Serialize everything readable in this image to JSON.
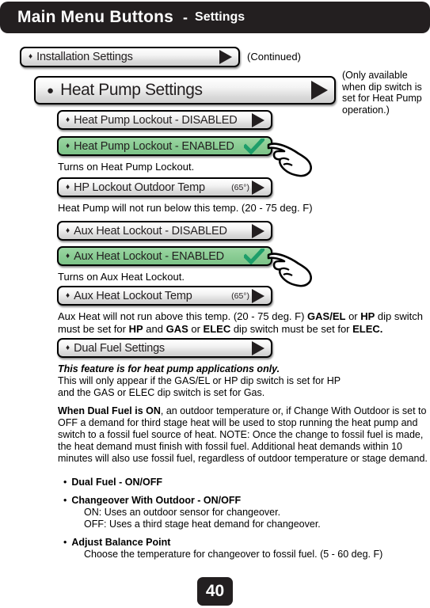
{
  "header": {
    "title": "Main Menu Buttons",
    "separator": "-",
    "subtitle": "Settings"
  },
  "buttons": {
    "installation_settings": {
      "label": "Installation Settings",
      "bullet": "♦",
      "arrow": "right-arrow"
    },
    "heat_pump_settings": {
      "label": "Heat Pump Settings",
      "bullet": "●",
      "arrow": "right-arrow"
    },
    "hp_lockout_disabled": {
      "label": "Heat Pump Lockout - DISABLED",
      "bullet": "♦",
      "arrow": "right-arrow"
    },
    "hp_lockout_enabled": {
      "label": "Heat Pump Lockout - ENABLED",
      "bullet": "♦",
      "state": "selected",
      "check": "checkmark"
    },
    "hp_lockout_outdoor_temp": {
      "label": "HP Lockout Outdoor Temp",
      "value": "(65°)",
      "bullet": "♦",
      "arrow": "right-arrow"
    },
    "aux_lockout_disabled": {
      "label": "Aux Heat Lockout - DISABLED",
      "bullet": "♦",
      "arrow": "right-arrow"
    },
    "aux_lockout_enabled": {
      "label": "Aux Heat Lockout - ENABLED",
      "bullet": "♦",
      "state": "selected",
      "check": "checkmark"
    },
    "aux_lockout_temp": {
      "label": "Aux Heat Lockout Temp",
      "value": "(65°)",
      "bullet": "♦",
      "arrow": "right-arrow"
    },
    "dual_fuel_settings": {
      "label": "Dual Fuel Settings",
      "bullet": "♦",
      "arrow": "right-arrow"
    }
  },
  "annotations": {
    "continued": "(Continued)",
    "dip_switch_note": "(Only available when dip switch is set for Heat Pump operation.)"
  },
  "descriptions": {
    "hp_lockout": "Turns on Heat Pump Lockout.",
    "hp_lockout_temp": "Heat Pump will not run below this temp. (20 - 75 deg. F)",
    "aux_lockout": "Turns on Aux Heat Lockout.",
    "aux_lockout_temp_line1_a": "Aux Heat will not run above this temp. (20 - 75 deg. F) ",
    "aux_lockout_temp_b1": "GAS/EL",
    "aux_lockout_temp_line1_b": " or ",
    "aux_lockout_temp_b2": "HP",
    "aux_lockout_temp_line1_c": " dip",
    "aux_lockout_temp_line2_a": "switch must be set for ",
    "aux_lockout_temp_b3": "HP",
    "aux_lockout_temp_line2_b": " and ",
    "aux_lockout_temp_b4": "GAS",
    "aux_lockout_temp_line2_c": " or ",
    "aux_lockout_temp_b5": "ELEC",
    "aux_lockout_temp_line2_d": " dip switch must be set for ",
    "aux_lockout_temp_b6": "ELEC."
  },
  "dual_fuel": {
    "heading": "This feature is for heat pump applications only.",
    "line1": "This will only appear if the GAS/EL or HP dip switch is set for HP",
    "line2": "and the GAS or ELEC dip switch is set for Gas.",
    "para_bold": "When Dual Fuel is ON",
    "para_rest": ", an outdoor temperature or, if Change With Outdoor is set to OFF a demand for third stage heat will be used to stop running the heat pump and switch to a fossil fuel source of heat.  NOTE:  Once the change to fossil fuel is made, the heat demand must finish with fossil fuel.  Additional heat demands within 10 minutes will also use fossil fuel, regardless of outdoor temperature or stage demand.",
    "bullets": [
      {
        "title": "Dual Fuel - ON/OFF",
        "subs": []
      },
      {
        "title": "Changeover With Outdoor - ON/OFF",
        "subs": [
          "ON: Uses an outdoor sensor for changeover.",
          "OFF: Uses a third stage heat demand for changeover."
        ]
      },
      {
        "title": "Adjust Balance Point",
        "subs": [
          "Choose the temperature for changeover to fossil fuel. (5 - 60 deg. F)"
        ]
      }
    ]
  },
  "footer": {
    "page_number": "40"
  },
  "colors": {
    "header_bg": "#231F20",
    "selected_green": "#8CCD95",
    "check_green": "#1E9E6A",
    "button_face": "#E6E6E6"
  }
}
